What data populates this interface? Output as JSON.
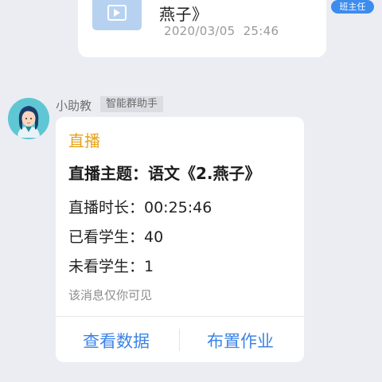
{
  "prev_message": {
    "video_title": "燕子》",
    "video_time": "2020/03/05  25:46",
    "role_badge": "班主任"
  },
  "assistant": {
    "name": "小助教",
    "tag": "智能群助手"
  },
  "card": {
    "type_label": "直播",
    "topic": "直播主题：语文《2.燕子》",
    "duration": "直播时长：00:25:46",
    "watched": "已看学生：40",
    "not_watched": "未看学生：1",
    "note": "该消息仅你可见",
    "actions": {
      "view_data": "查看数据",
      "assign_homework": "布置作业"
    }
  },
  "colors": {
    "accent": "#3c84e6",
    "live_label": "#e5a31a",
    "badge": "#3c8cf0"
  }
}
